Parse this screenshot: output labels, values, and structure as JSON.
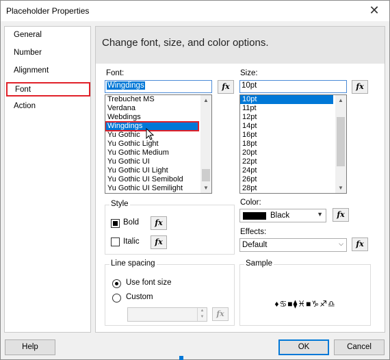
{
  "window": {
    "title": "Placeholder Properties"
  },
  "nav": {
    "items": [
      {
        "label": "General"
      },
      {
        "label": "Number"
      },
      {
        "label": "Alignment"
      },
      {
        "label": "Font",
        "selected": true
      },
      {
        "label": "Action"
      }
    ]
  },
  "header": {
    "text": "Change font, size, and color options."
  },
  "font": {
    "label": "Font:",
    "value": "Wingdings",
    "fx": "fx",
    "options": [
      "Trebuchet MS",
      "Verdana",
      "Webdings",
      "Wingdings",
      "Yu Gothic",
      "Yu Gothic Light",
      "Yu Gothic Medium",
      "Yu Gothic UI",
      "Yu Gothic UI Light",
      "Yu Gothic UI Semibold",
      "Yu Gothic UI Semilight"
    ],
    "selected": "Wingdings"
  },
  "size": {
    "label": "Size:",
    "value": "10pt",
    "fx": "fx",
    "options": [
      "10pt",
      "11pt",
      "12pt",
      "14pt",
      "16pt",
      "18pt",
      "20pt",
      "22pt",
      "24pt",
      "26pt",
      "28pt"
    ],
    "selected": "10pt"
  },
  "style": {
    "title": "Style",
    "bold": {
      "label": "Bold",
      "checked": true
    },
    "italic": {
      "label": "Italic",
      "checked": false
    }
  },
  "color": {
    "label": "Color:",
    "value": "Black",
    "swatch": "#000000"
  },
  "effects": {
    "label": "Effects:",
    "value": "Default"
  },
  "line_spacing": {
    "title": "Line spacing",
    "use_font_size": {
      "label": "Use font size",
      "checked": true
    },
    "custom": {
      "label": "Custom",
      "checked": false
    }
  },
  "sample": {
    "title": "Sample",
    "text": "♦♋■⧫♓■♑♐♎"
  },
  "buttons": {
    "help": "Help",
    "ok": "OK",
    "cancel": "Cancel"
  },
  "icons": {
    "close": "close-icon",
    "scroll_up": "chevron-up-icon",
    "scroll_down": "chevron-down-icon",
    "dropdown": "chevron-down-icon"
  },
  "colors": {
    "accent": "#0078d7",
    "highlight_border": "#e02028"
  }
}
